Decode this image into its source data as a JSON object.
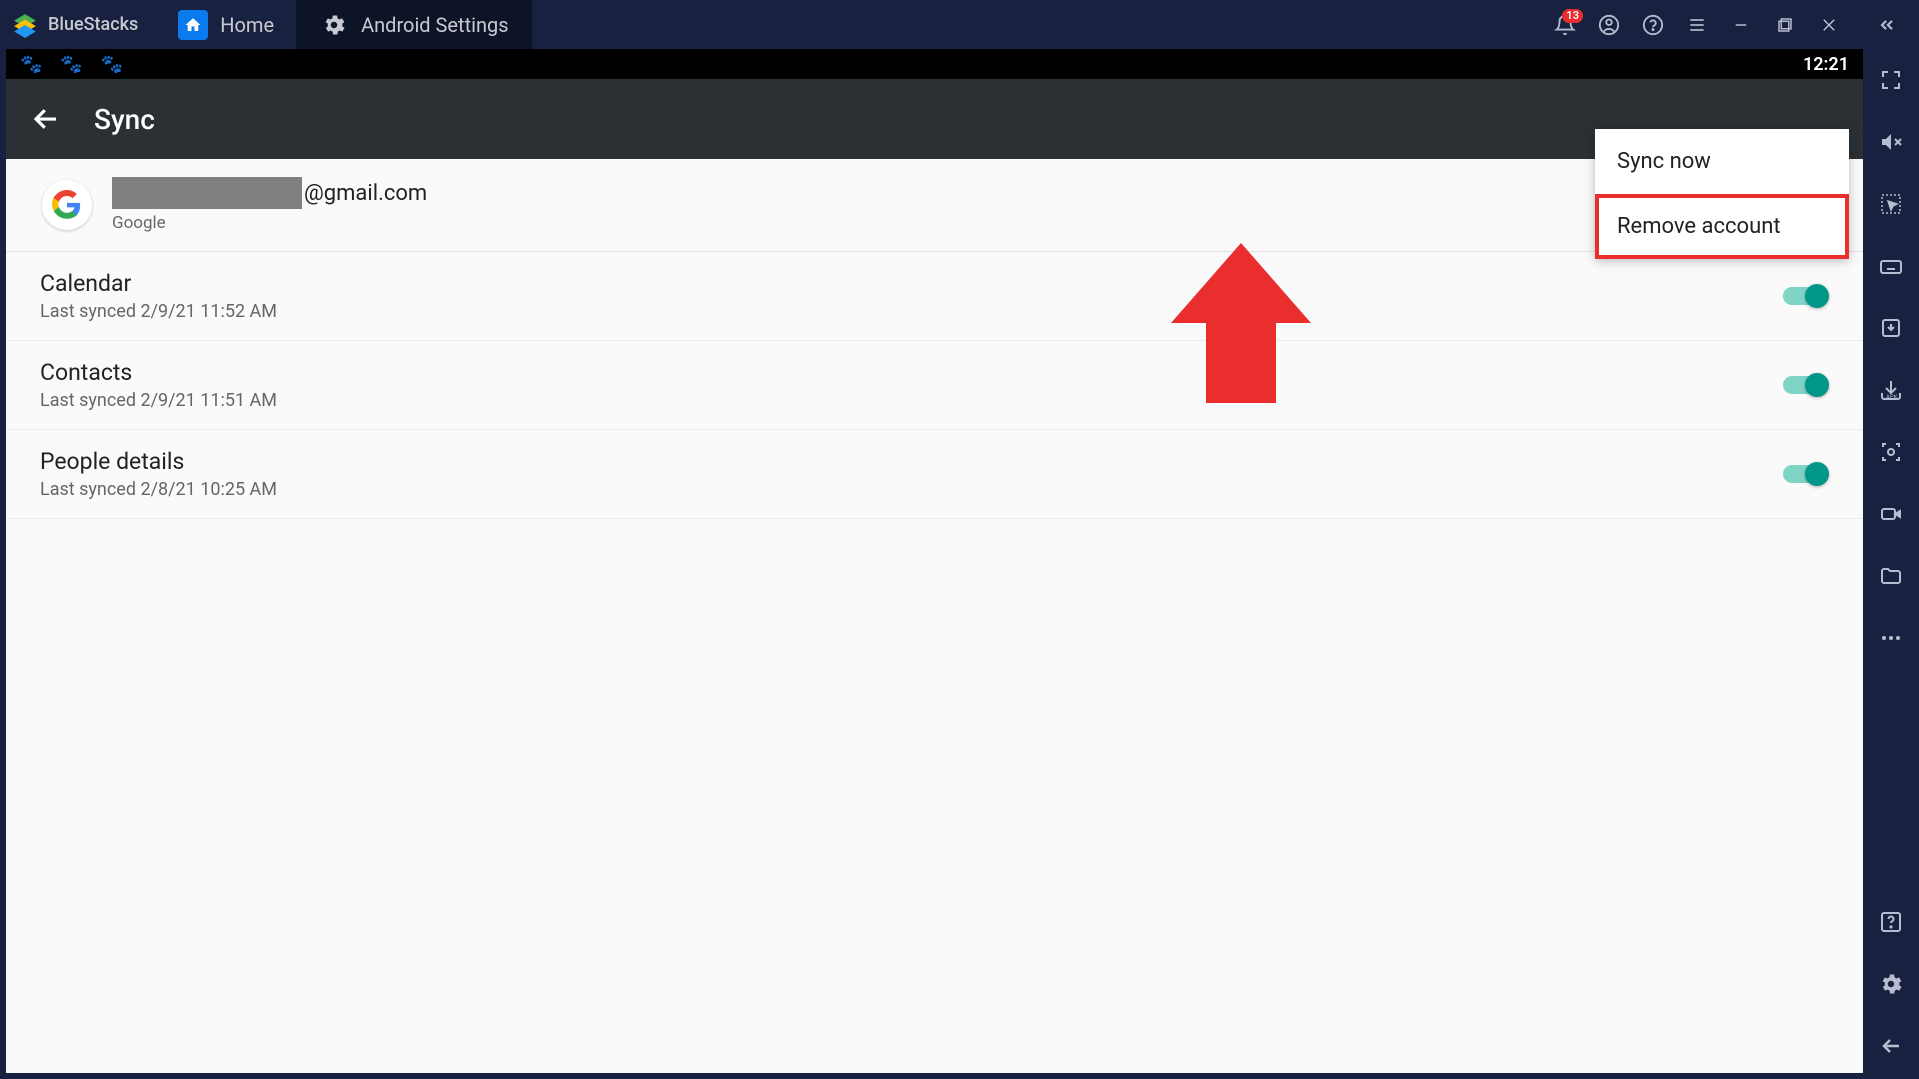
{
  "brand": "BlueStacks",
  "tabs": {
    "home": "Home",
    "settings": "Android Settings"
  },
  "notification_badge": "13",
  "android": {
    "clock": "12:21",
    "title": "Sync",
    "account": {
      "email_suffix": "@gmail.com",
      "provider": "Google"
    },
    "items": [
      {
        "name": "Calendar",
        "sub": "Last synced 2/9/21 11:52 AM"
      },
      {
        "name": "Contacts",
        "sub": "Last synced 2/9/21 11:51 AM"
      },
      {
        "name": "People details",
        "sub": "Last synced 2/8/21 10:25 AM"
      }
    ],
    "menu": {
      "sync_now": "Sync now",
      "remove": "Remove account"
    }
  }
}
